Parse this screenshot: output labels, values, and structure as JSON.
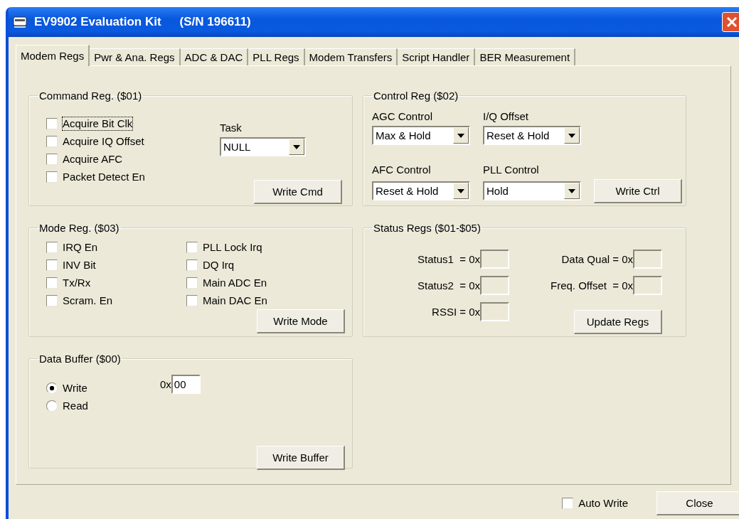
{
  "window": {
    "title": "EV9902 Evaluation Kit",
    "serial": "(S/N 196611)"
  },
  "tabs": [
    {
      "label": "Modem Regs",
      "selected": true
    },
    {
      "label": "Pwr & Ana. Regs",
      "selected": false
    },
    {
      "label": "ADC & DAC",
      "selected": false
    },
    {
      "label": "PLL Regs",
      "selected": false
    },
    {
      "label": "Modem Transfers",
      "selected": false
    },
    {
      "label": "Script Handler",
      "selected": false
    },
    {
      "label": "BER Measurement",
      "selected": false
    }
  ],
  "command_reg": {
    "legend": "Command Reg. ($01)",
    "checkboxes": [
      {
        "label": "Acquire Bit Clk",
        "checked": false,
        "focused": true
      },
      {
        "label": "Acquire IQ Offset",
        "checked": false,
        "focused": false
      },
      {
        "label": "Acquire AFC",
        "checked": false,
        "focused": false
      },
      {
        "label": "Packet Detect En",
        "checked": false,
        "focused": false
      }
    ],
    "task": {
      "label": "Task",
      "value": "NULL"
    },
    "button": "Write Cmd"
  },
  "control_reg": {
    "legend": "Control Reg ($02)",
    "dropdowns": [
      {
        "label": "AGC Control",
        "value": "Max & Hold"
      },
      {
        "label": "I/Q Offset",
        "value": "Reset & Hold"
      },
      {
        "label": "AFC Control",
        "value": "Reset & Hold"
      },
      {
        "label": "PLL Control",
        "value": "Hold"
      }
    ],
    "button": "Write Ctrl"
  },
  "mode_reg": {
    "legend": "Mode Reg. ($03)",
    "checkboxes": [
      {
        "label": "IRQ En",
        "checked": false
      },
      {
        "label": "INV Bit",
        "checked": false
      },
      {
        "label": "Tx/Rx",
        "checked": false
      },
      {
        "label": "Scram. En",
        "checked": false
      },
      {
        "label": "PLL Lock Irq",
        "checked": false
      },
      {
        "label": "DQ Irq",
        "checked": false
      },
      {
        "label": "Main ADC En",
        "checked": false
      },
      {
        "label": "Main DAC En",
        "checked": false
      }
    ],
    "button": "Write Mode"
  },
  "status_regs": {
    "legend": "Status Regs ($01-$05)",
    "fields": [
      {
        "label": "Status1  = 0x"
      },
      {
        "label": "Data Qual = 0x"
      },
      {
        "label": "Status2  = 0x"
      },
      {
        "label": "Freq. Offset  = 0x"
      },
      {
        "label": "RSSI = 0x"
      }
    ],
    "button": "Update Regs"
  },
  "data_buffer": {
    "legend": "Data Buffer ($00)",
    "radios": [
      {
        "label": "Write",
        "selected": true
      },
      {
        "label": "Read",
        "selected": false
      }
    ],
    "prefix": "0x",
    "value": "00",
    "button": "Write Buffer"
  },
  "footer": {
    "auto_write": {
      "label": "Auto Write",
      "checked": false
    },
    "close": "Close"
  }
}
